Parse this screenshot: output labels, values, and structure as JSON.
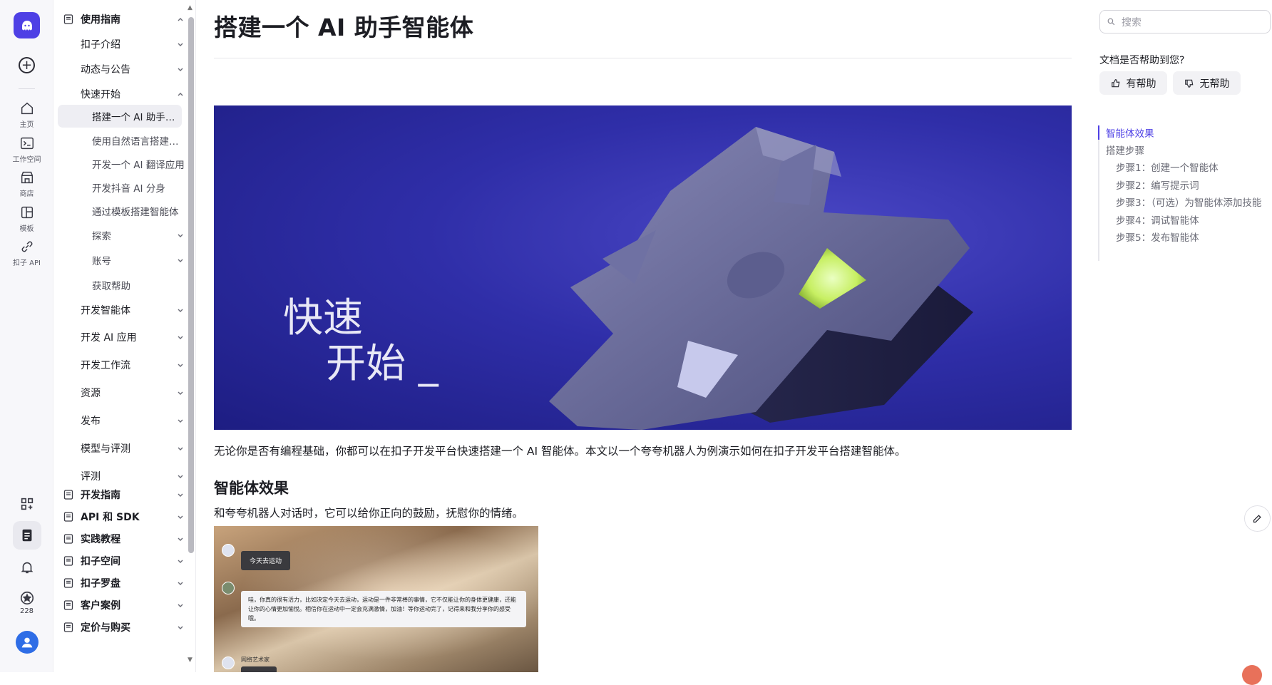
{
  "rail": {
    "nav": [
      {
        "label": "主页",
        "icon": "home-icon"
      },
      {
        "label": "工作空间",
        "icon": "terminal-icon"
      },
      {
        "label": "商店",
        "icon": "store-icon"
      },
      {
        "label": "模板",
        "icon": "template-icon"
      },
      {
        "label": "扣子 API",
        "icon": "link-icon"
      }
    ],
    "points": "228"
  },
  "sidebar": {
    "items": [
      {
        "label": "使用指南",
        "level": 0,
        "chevron": "up"
      },
      {
        "label": "扣子介绍",
        "level": 1,
        "chevron": "down"
      },
      {
        "label": "动态与公告",
        "level": 1,
        "chevron": "down"
      },
      {
        "label": "快速开始",
        "level": 1,
        "chevron": "up"
      },
      {
        "label": "搭建一个 AI 助手智能体",
        "level": 2,
        "active": true
      },
      {
        "label": "使用自然语言搭建智能体",
        "level": 2
      },
      {
        "label": "开发一个 AI 翻译应用",
        "level": 2
      },
      {
        "label": "开发抖音 AI 分身",
        "level": 2
      },
      {
        "label": "通过模板搭建智能体",
        "level": 2
      },
      {
        "label": "探索",
        "level": 2,
        "chevron": "down"
      },
      {
        "label": "账号",
        "level": 2,
        "chevron": "down"
      },
      {
        "label": "获取帮助",
        "level": 2
      },
      {
        "label": "开发智能体",
        "level": 1,
        "chevron": "down"
      },
      {
        "label": "开发 AI 应用",
        "level": 1,
        "chevron": "down"
      },
      {
        "label": "开发工作流",
        "level": 1,
        "chevron": "down"
      },
      {
        "label": "资源",
        "level": 1,
        "chevron": "down"
      },
      {
        "label": "发布",
        "level": 1,
        "chevron": "down"
      },
      {
        "label": "模型与评测",
        "level": 1,
        "chevron": "down"
      },
      {
        "label": "评测",
        "level": 1,
        "chevron": "down"
      },
      {
        "label": "开发指南",
        "level": 0,
        "chevron": "down"
      },
      {
        "label": "API 和 SDK",
        "level": 0,
        "chevron": "down"
      },
      {
        "label": "实践教程",
        "level": 0,
        "chevron": "down"
      },
      {
        "label": "扣子空间",
        "level": 0,
        "chevron": "down"
      },
      {
        "label": "扣子罗盘",
        "level": 0,
        "chevron": "down"
      },
      {
        "label": "客户案例",
        "level": 0,
        "chevron": "down"
      },
      {
        "label": "定价与购买",
        "level": 0,
        "chevron": "down"
      }
    ]
  },
  "article": {
    "title": "搭建一个 AI 助手智能体",
    "hero_line1": "快速",
    "hero_line2": "开始 _",
    "intro": "无论你是否有编程基础，你都可以在扣子开发平台快速搭建一个 AI 智能体。本文以一个夸夸机器人为例演示如何在扣子开发平台搭建智能体。",
    "section_title": "智能体效果",
    "section_text": "和夸夸机器人对话时，它可以给你正向的鼓励，抚慰你的情绪。",
    "chat": {
      "user_msg": "今天去运动",
      "bot_reply": "哇，你真的很有活力，比如决定今天去运动，运动是一件非常棒的事情，它不仅能让你的身体更健康，还能让你的心情更加愉悦。相信你在运动中一定会充满激情，加油！等你运动完了，记得来和我分享你的感受哦。",
      "bot_name": "网络艺术家"
    }
  },
  "right": {
    "search_placeholder": "搜索",
    "feedback_question": "文档是否帮助到您?",
    "helpful": "有帮助",
    "not_helpful": "无帮助",
    "toc": [
      {
        "label": "智能体效果",
        "level": 0,
        "active": true
      },
      {
        "label": "搭建步骤",
        "level": 0
      },
      {
        "label": "步骤1：创建一个智能体",
        "level": 1
      },
      {
        "label": "步骤2：编写提示词",
        "level": 1
      },
      {
        "label": "步骤3：（可选）为智能体添加技能",
        "level": 1
      },
      {
        "label": "步骤4：调试智能体",
        "level": 1
      },
      {
        "label": "步骤5：发布智能体",
        "level": 1
      }
    ]
  },
  "colors": {
    "accent": "#4e40e5",
    "hero_bg": "#2f2ea8",
    "avatar": "#2e6de6"
  }
}
